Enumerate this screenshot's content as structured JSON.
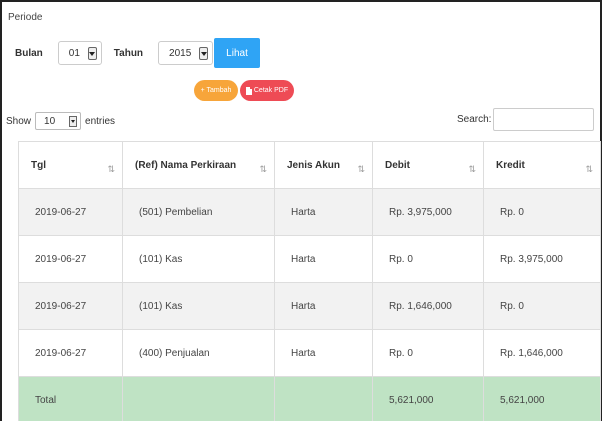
{
  "filter": {
    "periode_label": "Periode",
    "bulan_label": "Bulan",
    "bulan_value": "01",
    "tahun_label": "Tahun",
    "tahun_value": "2015",
    "lihat_label": "Lihat"
  },
  "actions": {
    "tambah_label": "+ Tambah",
    "cetak_label": "Cetak PDF",
    "tambah_color": "#f7a53a",
    "cetak_color": "#ee4b55",
    "lihat_color": "#2fa4f5"
  },
  "table_controls": {
    "show_label": "Show",
    "entries_value": "10",
    "entries_label": "entries",
    "search_label": "Search:"
  },
  "table": {
    "headers": [
      "Tgl",
      "(Ref) Nama Perkiraan",
      "Jenis Akun",
      "Debit",
      "Kredit"
    ],
    "sort_icon": "⇅",
    "rows": [
      [
        "2019-06-27",
        "(501) Pembelian",
        "Harta",
        "Rp. 3,975,000",
        "Rp. 0"
      ],
      [
        "2019-06-27",
        "(101) Kas",
        "Harta",
        "Rp. 0",
        "Rp. 3,975,000"
      ],
      [
        "2019-06-27",
        "(101) Kas",
        "Harta",
        "Rp. 1,646,000",
        "Rp. 0"
      ],
      [
        "2019-06-27",
        "(400) Penjualan",
        "Harta",
        "Rp. 0",
        "Rp. 1,646,000"
      ]
    ],
    "total": [
      "Total",
      "",
      "",
      "5,621,000",
      "5,621,000"
    ],
    "total_color": "#bfe3c4"
  }
}
